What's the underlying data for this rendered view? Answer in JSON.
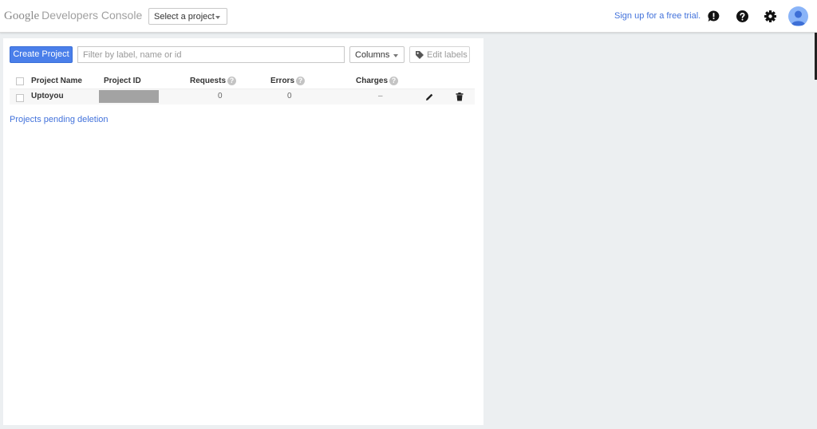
{
  "header": {
    "brand_google": "Google",
    "brand_product": "Developers Console",
    "project_select": "Select a project",
    "trial_link": "Sign up for a free trial.",
    "icons": [
      "feedback-icon",
      "help-icon",
      "gear-icon",
      "avatar"
    ]
  },
  "toolbar": {
    "create_label": "Create Project",
    "filter_placeholder": "Filter by label, name or id",
    "columns_label": "Columns",
    "edit_labels": "Edit labels"
  },
  "table": {
    "columns": [
      "Project Name",
      "Project ID",
      "Requests",
      "Errors",
      "Charges"
    ],
    "rows": [
      {
        "name": "Uptoyou",
        "id": "",
        "requests": "0",
        "errors": "0",
        "charges": "–"
      }
    ]
  },
  "pending_link": "Projects pending deletion",
  "colors": {
    "accent": "#4a7fea",
    "link": "#4272db",
    "background": "#eceff1"
  }
}
